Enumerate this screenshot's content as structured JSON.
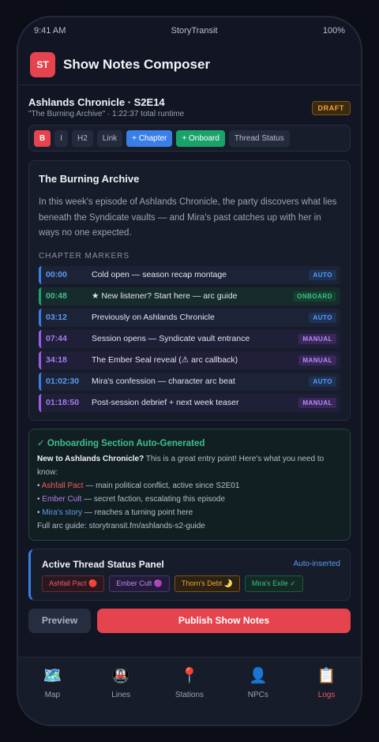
{
  "status_bar": {
    "time": "9:41 AM",
    "carrier": "StoryTransit",
    "battery": "100%"
  },
  "header": {
    "logo_text": "ST",
    "title": "Show Notes Composer"
  },
  "episode": {
    "title": "Ashlands Chronicle · S2E14",
    "subtitle": "\"The Burning Archive\" · 1:22:37 total runtime",
    "badge": "DRAFT"
  },
  "toolbar": {
    "bold": "B",
    "italic": "I",
    "h2": "H2",
    "link": "Link",
    "chapter": "+ Chapter",
    "onboard": "+ Onboard",
    "thread_status": "Thread Status"
  },
  "editor": {
    "heading": "The Burning Archive",
    "paragraph": "In this week's episode of Ashlands Chronicle, the party discovers what lies beneath the Syndicate vaults — and Mira's past catches up with her in ways no one expected.",
    "chapters_label": "CHAPTER MARKERS",
    "chapters": [
      {
        "time": "00:00",
        "title": "Cold open — season recap montage",
        "tag": "AUTO",
        "kind": "auto"
      },
      {
        "time": "00:48",
        "title": "★ New listener? Start here — arc guide",
        "tag": "ONBOARD",
        "kind": "onboard"
      },
      {
        "time": "03:12",
        "title": "Previously on Ashlands Chronicle",
        "tag": "AUTO",
        "kind": "auto"
      },
      {
        "time": "07:44",
        "title": "Session opens — Syndicate vault entrance",
        "tag": "MANUAL",
        "kind": "manual"
      },
      {
        "time": "34:18",
        "title": "The Ember Seal reveal (⚠ arc callback)",
        "tag": "MANUAL",
        "kind": "manual"
      },
      {
        "time": "01:02:30",
        "title": "Mira's confession — character arc beat",
        "tag": "AUTO",
        "kind": "auto"
      },
      {
        "time": "01:18:50",
        "title": "Post-session debrief + next week teaser",
        "tag": "MANUAL",
        "kind": "manual"
      }
    ]
  },
  "onboarding": {
    "heading": "✓ Onboarding Section Auto-Generated",
    "intro_bold": "New to Ashlands Chronicle?",
    "intro_rest": " This is a great entry point! Here's what you need to know:",
    "items": [
      {
        "bullet": "• ",
        "name": "Ashfall Pact",
        "desc": " — main political conflict, active since S2E01",
        "color": "red"
      },
      {
        "bullet": "• ",
        "name": "Ember Cult",
        "desc": " — secret faction, escalating this episode",
        "color": "purple"
      },
      {
        "bullet": "• ",
        "name": "Mira's story",
        "desc": " — reaches a turning point here",
        "color": "blue"
      }
    ],
    "guide": "Full arc guide: storytransit.fm/ashlands-s2-guide"
  },
  "thread_panel": {
    "title": "Active Thread Status Panel",
    "auto_label": "Auto-inserted",
    "chips": [
      {
        "label": "Ashfall Pact 🔴",
        "kind": "ashfall"
      },
      {
        "label": "Ember Cult 🟣",
        "kind": "ember"
      },
      {
        "label": "Thorn's Debt 🌛",
        "kind": "thorn"
      },
      {
        "label": "Mira's Exile ✓",
        "kind": "mira"
      }
    ]
  },
  "actions": {
    "preview": "Preview",
    "publish": "Publish Show Notes"
  },
  "tabbar": [
    {
      "icon": "🗺️",
      "icon_name": "map-icon",
      "label": "Map",
      "active": false
    },
    {
      "icon": "🚇",
      "icon_name": "train-icon",
      "label": "Lines",
      "active": false
    },
    {
      "icon": "📍",
      "icon_name": "pin-icon",
      "label": "Stations",
      "active": false
    },
    {
      "icon": "👤",
      "icon_name": "person-icon",
      "label": "NPCs",
      "active": false
    },
    {
      "icon": "📋",
      "icon_name": "clipboard-icon",
      "label": "Logs",
      "active": true
    }
  ],
  "colors": {
    "accent": "#e5434d",
    "auto": "#3a7fe8",
    "manual": "#9b5de5",
    "onboard": "#19a36a",
    "draft": "#f0a33a"
  }
}
